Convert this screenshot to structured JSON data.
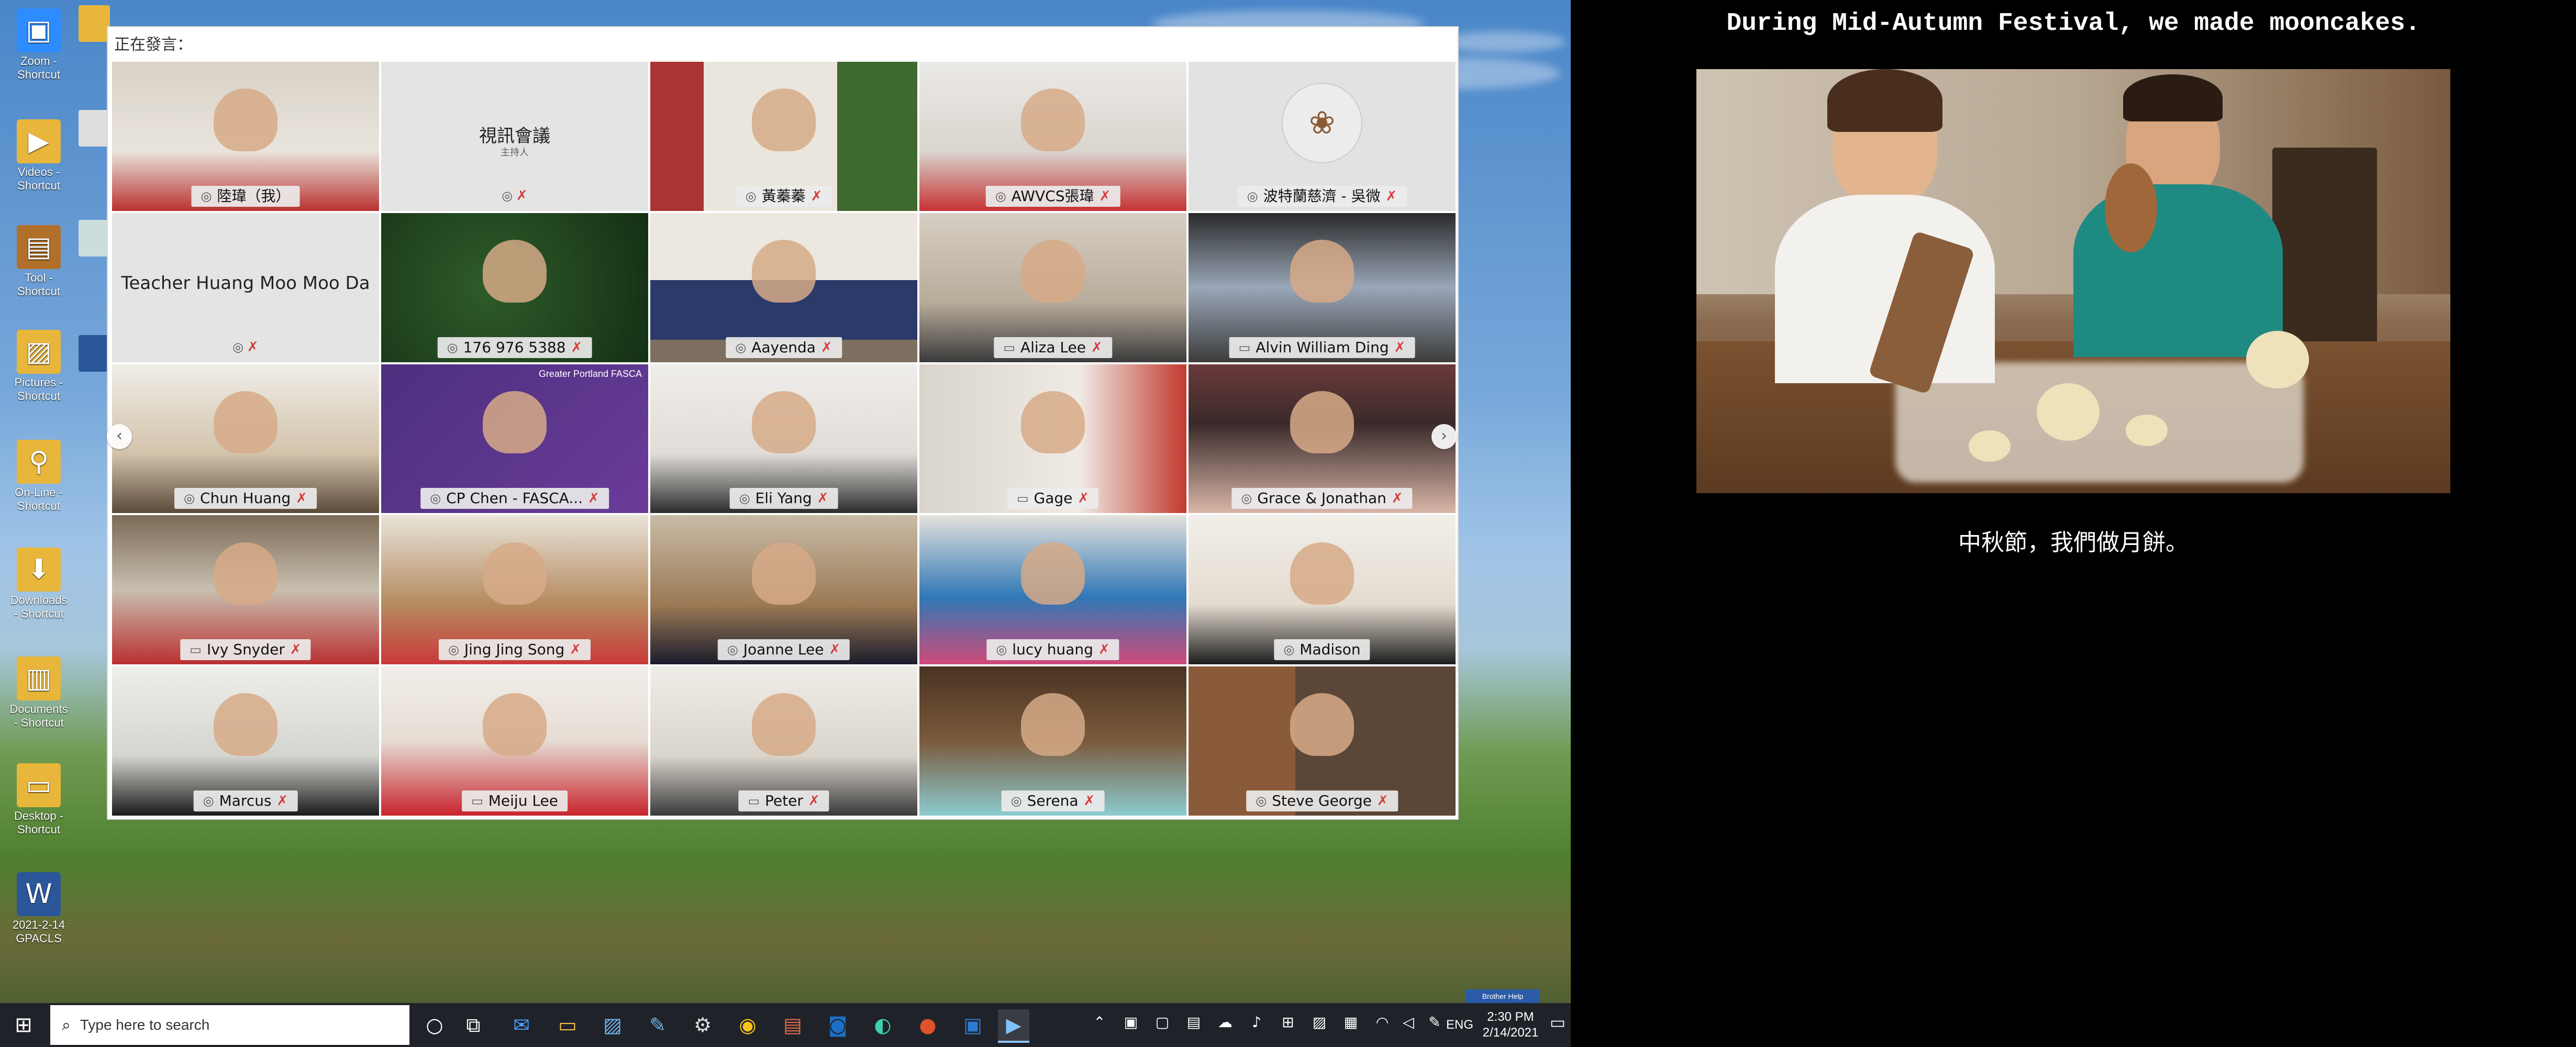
{
  "desktop": {
    "icons": [
      {
        "label": "Zoom - Shortcut",
        "icon": "zoom-icon",
        "glyph": "▣",
        "color": "#2d8cff"
      },
      {
        "label": "Videos - Shortcut",
        "icon": "videos-folder-icon",
        "glyph": "▶",
        "color": "#e8b63a"
      },
      {
        "label": "Tool - Shortcut",
        "icon": "toolbox-icon",
        "glyph": "▤",
        "color": "#b0702a"
      },
      {
        "label": "Pictures - Shortcut",
        "icon": "pictures-folder-icon",
        "glyph": "▨",
        "color": "#e8b63a"
      },
      {
        "label": "On-Line - Shortcut",
        "icon": "online-folder-icon",
        "glyph": "⚲",
        "color": "#e8b63a"
      },
      {
        "label": "Downloads - Shortcut",
        "icon": "downloads-folder-icon",
        "glyph": "⬇",
        "color": "#e8b63a"
      },
      {
        "label": "Documents - Shortcut",
        "icon": "documents-folder-icon",
        "glyph": "▥",
        "color": "#e8b63a"
      },
      {
        "label": "Desktop - Shortcut",
        "icon": "desktop-folder-icon",
        "glyph": "▭",
        "color": "#e8b63a"
      },
      {
        "label": "2021-2-14 GPACLS",
        "icon": "word-document-icon",
        "glyph": "W",
        "color": "#2b579a"
      }
    ]
  },
  "zoom": {
    "speaking_label": "正在發言：",
    "participants": [
      {
        "name": "陸瑋（我）",
        "active": true,
        "type": "video",
        "mic": true,
        "muted": false
      },
      {
        "name": "視訊會議",
        "subtitle": "主持人",
        "type": "text",
        "mic": true,
        "muted": true
      },
      {
        "name": "黃蓁蓁",
        "type": "video",
        "mic": true,
        "muted": true
      },
      {
        "name": "AWVCS張瑋",
        "type": "video",
        "mic": true,
        "muted": true
      },
      {
        "name": "波特蘭慈濟 - 吳微",
        "type": "logo",
        "mic": true,
        "muted": true
      },
      {
        "name": "Teacher Huang Moo Moo Da",
        "type": "text",
        "mic": true,
        "muted": true
      },
      {
        "name": "176 976 5388",
        "type": "video",
        "mic": true,
        "muted": true
      },
      {
        "name": "Aayenda",
        "type": "video",
        "mic": true,
        "muted": true
      },
      {
        "name": "Aliza Lee",
        "type": "video",
        "mic": false,
        "muted": true
      },
      {
        "name": "Alvin William Ding",
        "type": "video",
        "mic": false,
        "muted": true
      },
      {
        "name": "Chun Huang",
        "type": "video",
        "mic": true,
        "muted": true
      },
      {
        "name": "CP Chen - FASCA...",
        "type": "video",
        "mic": true,
        "muted": true,
        "overlay": "Greater Portland FASCA"
      },
      {
        "name": "Eli Yang",
        "type": "video",
        "mic": true,
        "muted": true
      },
      {
        "name": "Gage",
        "type": "video",
        "mic": false,
        "muted": true
      },
      {
        "name": "Grace & Jonathan",
        "type": "video",
        "mic": true,
        "muted": true
      },
      {
        "name": "Ivy Snyder",
        "type": "video",
        "mic": false,
        "muted": true
      },
      {
        "name": "Jing Jing Song",
        "type": "video",
        "mic": true,
        "muted": true
      },
      {
        "name": "Joanne Lee",
        "type": "video",
        "mic": true,
        "muted": true
      },
      {
        "name": "lucy huang",
        "type": "video",
        "mic": true,
        "muted": true
      },
      {
        "name": "Madison",
        "type": "video",
        "mic": true,
        "muted": false
      },
      {
        "name": "Marcus",
        "type": "video",
        "mic": true,
        "muted": true
      },
      {
        "name": "Meiju Lee",
        "type": "video",
        "mic": false,
        "muted": false
      },
      {
        "name": "Peter",
        "type": "video",
        "mic": false,
        "muted": true
      },
      {
        "name": "Serena",
        "type": "video",
        "mic": true,
        "muted": true
      },
      {
        "name": "Steve George",
        "type": "video",
        "mic": true,
        "muted": true
      }
    ]
  },
  "taskbar": {
    "search_placeholder": "Type here to search",
    "language": "ENG",
    "time": "2:30 PM",
    "date": "2/14/2021",
    "brother_help": "Brother Help"
  },
  "slide": {
    "title": "During Mid-Autumn Festival, we made mooncakes.",
    "caption": "中秋節，我們做月餅。"
  }
}
